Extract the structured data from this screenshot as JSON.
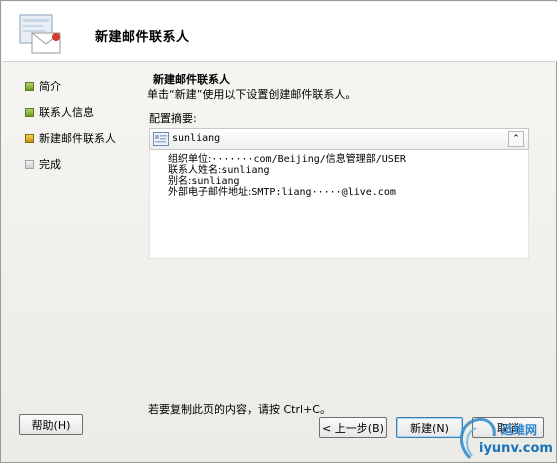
{
  "header": {
    "title": "新建邮件联系人"
  },
  "nav": {
    "items": [
      {
        "label": "简介",
        "state": "done"
      },
      {
        "label": "联系人信息",
        "state": "done"
      },
      {
        "label": "新建邮件联系人",
        "state": "current"
      },
      {
        "label": "完成",
        "state": "pending"
      }
    ]
  },
  "content": {
    "title": "新建邮件联系人",
    "description": "单击“新建”使用以下设置创建邮件联系人。",
    "summary_label": "配置摘要:",
    "contact_name": "sunliang",
    "properties": [
      {
        "key": "组织单位:",
        "value": "·······com/Beijing/信息管理部/USER"
      },
      {
        "key": "联系人姓名:",
        "value": "sunliang"
      },
      {
        "key": "别名:",
        "value": "sunliang"
      },
      {
        "key": "外部电子邮件地址:",
        "value": "SMTP:liang·····@live.com"
      }
    ],
    "copy_hint": "若要复制此页的内容，请按 Ctrl+C。"
  },
  "buttons": {
    "help": "帮助(H)",
    "back": "< 上一步(B)",
    "next": "新建(N)",
    "cancel": "取消"
  },
  "watermark": {
    "text": "iyunv.com",
    "cn": "运维网"
  },
  "colors": {
    "accent": "#3c7fb1",
    "done_bullet": "#6e9a25",
    "current_bullet": "#c39313",
    "watermark": "#1a73b8"
  }
}
